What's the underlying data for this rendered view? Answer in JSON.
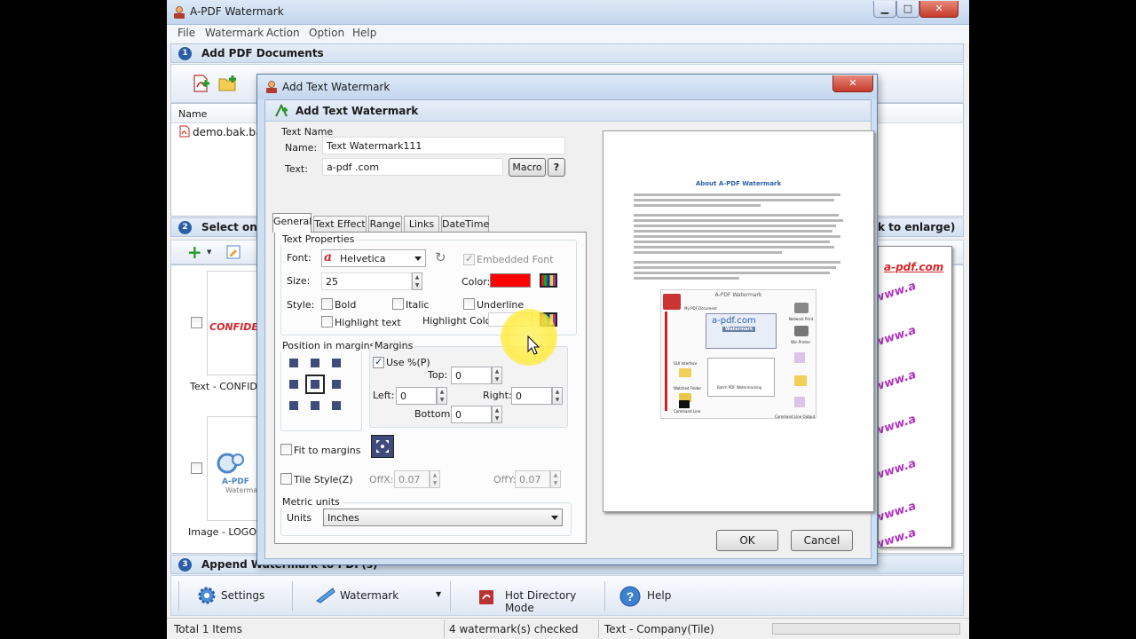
{
  "main_window": {
    "title": "A-PDF Watermark",
    "controls": {
      "minimize": "▁",
      "maximize": "□",
      "close": "✕"
    },
    "menu": [
      "File",
      "Watermark",
      "Action",
      "Option",
      "Help"
    ],
    "step1": {
      "num": "1",
      "label": "Add PDF Documents"
    },
    "file_list": {
      "column_name": "Name",
      "files": [
        "demo.bak.bak.p"
      ]
    },
    "step2": {
      "num": "2",
      "label": "Select one",
      "label_right": "k to enlarge)"
    },
    "watermarks": [
      {
        "thumb_text": "CONFIDEN",
        "caption": "Text - CONFIDE"
      },
      {
        "thumb_text": "A-PDF",
        "thumb_text2": "Waterma",
        "caption": "Image - LOGO (c"
      }
    ],
    "preview_right": {
      "site": "a-pdf.com",
      "tiles": [
        "www.a",
        "www.a",
        "www.a",
        "www.a",
        "www.a",
        "www.a",
        "www.a"
      ]
    },
    "step3": {
      "num": "3",
      "label": "Append Watermark to PDF(s)"
    },
    "bottom_toolbar": {
      "settings": "Settings",
      "watermark": "Watermark",
      "hot_directory": "Hot Directory Mode",
      "help": "Help"
    },
    "status": {
      "items": "Total 1 Items",
      "checked": "4 watermark(s) checked",
      "current": "Text - Company(Tile)"
    }
  },
  "dialog": {
    "title": "Add Text Watermark",
    "header": "Add Text Watermark",
    "text_name_group": "Text Name",
    "name_label": "Name:",
    "name_value": "Text Watermark111",
    "text_label": "Text:",
    "text_value": "a-pdf .com",
    "macro_button": "Macro",
    "help_button": "?",
    "tabs": [
      "General",
      "Text Effect",
      "Range",
      "Links",
      "DateTime"
    ],
    "text_properties": {
      "group": "Text Properties",
      "font_label": "Font:",
      "font_value": "Helvetica",
      "embedded_font": "Embedded Font",
      "size_label": "Size:",
      "size_value": "25",
      "color_label": "Color:",
      "color_value": "#ff0000",
      "style_label": "Style:",
      "bold": "Bold",
      "italic": "Italic",
      "underline": "Underline",
      "highlight_text": "Highlight text",
      "highlight_color_label": "Highlight Color:"
    },
    "position": {
      "group": "Position in margins"
    },
    "margins": {
      "group": "Margins",
      "use_percent": "Use %(P)",
      "top_label": "Top:",
      "top_value": "0",
      "left_label": "Left:",
      "left_value": "0",
      "right_label": "Right:",
      "right_value": "0",
      "bottom_label": "Bottom:",
      "bottom_value": "0"
    },
    "fit_to_margins": "Fit to margins",
    "tile_style": "Tile Style(Z)",
    "offx_label": "OffX:",
    "offx_value": "0.07",
    "offy_label": "OffY:",
    "offy_value": "0.07",
    "metric": {
      "group": "Metric units",
      "units_label": "Units",
      "units_value": "Inches"
    },
    "preview": {
      "heading": "About A-PDF Watermark",
      "diagram_title": "A-PDF Watermark",
      "diagram_site": "a-pdf.com",
      "diagram_center": "Watermark",
      "diagram_label_doc": "My PDF Document",
      "diagram_label_gui": "GUI Interface",
      "diagram_label_watched": "Watched Folder",
      "diagram_label_cmd": "Command Line",
      "diagram_label_batch": "Batch PDF Watermarking",
      "diagram_label_output": "Command Line Output",
      "diagram_label_network": "Network Print",
      "diagram_label_win": "Win Printer"
    },
    "ok_button": "OK",
    "cancel_button": "Cancel"
  }
}
